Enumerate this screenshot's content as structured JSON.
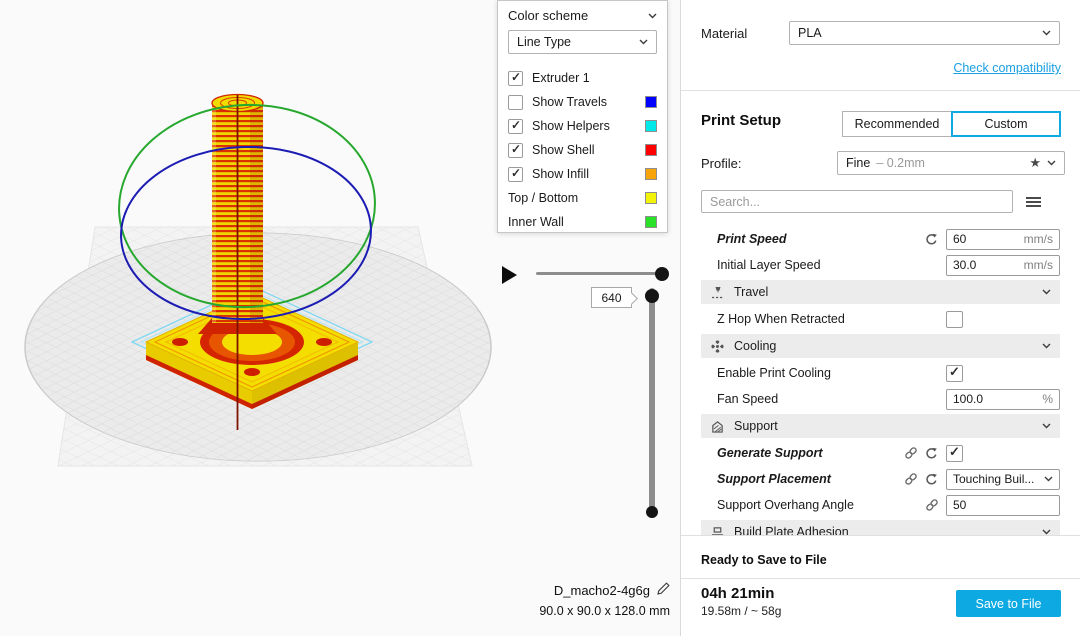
{
  "colors": {
    "accent": "#0ca9e3",
    "link": "#1a9fe0"
  },
  "scene": {
    "plate": "#ebebeb",
    "model_top_bottom": "#f4de00",
    "model_shell": "#d52500",
    "helper_ring": "#27a82f",
    "travel_ring": "#1c1cb4",
    "skirt": "#7fd8f2",
    "seam": "#7e1200"
  },
  "view_panel": {
    "title": "Color scheme",
    "scheme": "Line Type",
    "rows": [
      {
        "label": "Extruder 1",
        "checkbox": true,
        "checked": true
      },
      {
        "label": "Show Travels",
        "checkbox": true,
        "checked": false,
        "swatch": "#0000ff"
      },
      {
        "label": "Show Helpers",
        "checkbox": true,
        "checked": true,
        "swatch": "#00e8e8"
      },
      {
        "label": "Show Shell",
        "checkbox": true,
        "checked": true,
        "swatch": "#ff0000"
      },
      {
        "label": "Show Infill",
        "checkbox": true,
        "checked": true,
        "swatch": "#f7a40b"
      },
      {
        "label": "Top / Bottom",
        "checkbox": false,
        "swatch": "#f3f309"
      },
      {
        "label": "Inner Wall",
        "checkbox": false,
        "swatch": "#29e129"
      }
    ]
  },
  "preview": {
    "layer": "640",
    "model_name": "D_macho2-4g6g",
    "model_size": "90.0 x 90.0 x 128.0 mm"
  },
  "sidebar": {
    "material": {
      "label": "Material",
      "value": "PLA"
    },
    "compatibility": "Check compatibility",
    "print_setup": {
      "title": "Print Setup",
      "recommended": "Recommended",
      "custom": "Custom"
    },
    "profile": {
      "label": "Profile:",
      "name": "Fine",
      "detail": "– 0.2mm"
    },
    "search": {
      "placeholder": "Search..."
    },
    "settings": [
      {
        "type": "value",
        "label": "Print Speed",
        "italic": true,
        "reset": true,
        "value": "60",
        "unit": "mm/s"
      },
      {
        "type": "value",
        "label": "Initial Layer Speed",
        "value": "30.0",
        "unit": "mm/s"
      },
      {
        "type": "category",
        "label": "Travel",
        "icon": "travel-icon"
      },
      {
        "type": "checkbox",
        "label": "Z Hop When Retracted",
        "checked": false
      },
      {
        "type": "category",
        "label": "Cooling",
        "icon": "cooling-icon"
      },
      {
        "type": "checkbox",
        "label": "Enable Print Cooling",
        "checked": true
      },
      {
        "type": "value",
        "label": "Fan Speed",
        "value": "100.0",
        "unit": "%"
      },
      {
        "type": "category",
        "label": "Support",
        "icon": "support-icon"
      },
      {
        "type": "checkbox",
        "label": "Generate Support",
        "italic": true,
        "link": true,
        "reset": true,
        "checked": true
      },
      {
        "type": "select",
        "label": "Support Placement",
        "italic": true,
        "link": true,
        "reset": true,
        "value": "Touching Buil..."
      },
      {
        "type": "value",
        "label": "Support Overhang Angle",
        "link": true,
        "value": "50",
        "unit": ""
      },
      {
        "type": "category",
        "label": "Build Plate Adhesion",
        "icon": "adhesion-icon"
      }
    ],
    "footer": {
      "status": "Ready to Save to File",
      "time": "04h 21min",
      "usage": "19.58m / ~ 58g",
      "save": "Save to File"
    }
  }
}
